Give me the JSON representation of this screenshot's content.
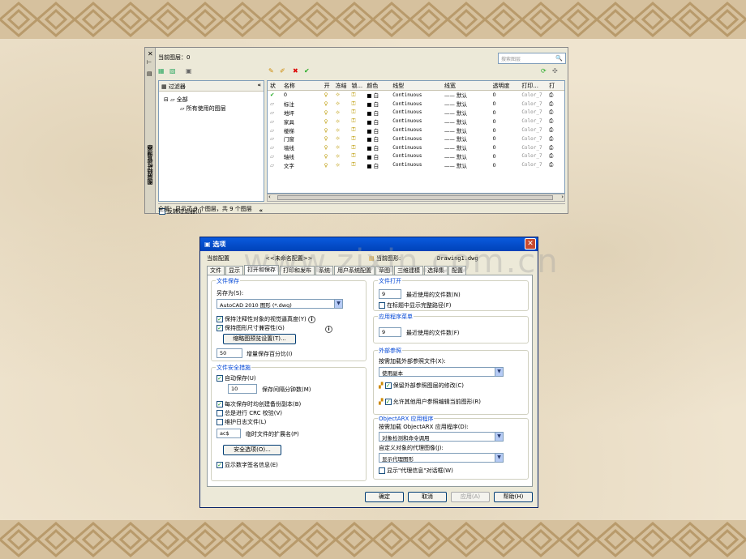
{
  "layer_manager": {
    "side_title": "图层特性管理器",
    "current_layer": "当前图层：0",
    "search_placeholder": "搜索图层",
    "filter_header": "过滤器",
    "tree_all": "全部",
    "tree_used": "所有使用的图层",
    "invert_filter": "反转过滤器(I)",
    "columns": [
      "状",
      "名称",
      "开",
      "冻结",
      "锁...",
      "颜色",
      "线型",
      "线宽",
      "透明度",
      "打印...",
      "打"
    ],
    "rows": [
      {
        "name": "0",
        "color": "白",
        "linetype": "Continuous",
        "lineweight": "默认",
        "transparency": "0",
        "plot": "Color_7"
      },
      {
        "name": "标注",
        "color": "白",
        "linetype": "Continuous",
        "lineweight": "默认",
        "transparency": "0",
        "plot": "Color_7"
      },
      {
        "name": "地坪",
        "color": "白",
        "linetype": "Continuous",
        "lineweight": "默认",
        "transparency": "0",
        "plot": "Color_7"
      },
      {
        "name": "家具",
        "color": "白",
        "linetype": "Continuous",
        "lineweight": "默认",
        "transparency": "0",
        "plot": "Color_7"
      },
      {
        "name": "楼梯",
        "color": "白",
        "linetype": "Continuous",
        "lineweight": "默认",
        "transparency": "0",
        "plot": "Color_7"
      },
      {
        "name": "门窗",
        "color": "白",
        "linetype": "Continuous",
        "lineweight": "默认",
        "transparency": "0",
        "plot": "Color_7"
      },
      {
        "name": "墙线",
        "color": "白",
        "linetype": "Continuous",
        "lineweight": "默认",
        "transparency": "0",
        "plot": "Color_7"
      },
      {
        "name": "轴线",
        "color": "白",
        "linetype": "Continuous",
        "lineweight": "默认",
        "transparency": "0",
        "plot": "Color_7"
      },
      {
        "name": "文字",
        "color": "白",
        "linetype": "Continuous",
        "lineweight": "默认",
        "transparency": "0",
        "plot": "Color_7"
      }
    ],
    "status": "全部：显示了 9 个图层，共 9 个图层"
  },
  "options": {
    "title": "选项",
    "current_profile_label": "当前配置",
    "current_profile_value": "<<未命名配置>>",
    "current_drawing_label": "当前图形:",
    "current_drawing_value": "Drawing1.dwg",
    "tabs": [
      "文件",
      "显示",
      "打开和保存",
      "打印和发布",
      "系统",
      "用户系统配置",
      "草图",
      "三维建模",
      "选择集",
      "配置"
    ],
    "active_tab": 2,
    "file_save": {
      "title": "文件保存",
      "save_as_label": "另存为(S):",
      "save_as_value": "AutoCAD 2010 图形 (*.dwg)",
      "keep_visual": "保持注释性对象的视觉逼真度(Y)",
      "keep_size": "保持图形尺寸兼容性(G)",
      "thumb_button": "缩略图预览设置(T)...",
      "incr_value": "50",
      "incr_label": "增量保存百分比(I)"
    },
    "file_safety": {
      "title": "文件安全措施",
      "autosave": "自动保存(U)",
      "minutes_value": "10",
      "minutes_label": "保存间隔分钟数(M)",
      "backup": "每次保存时均创建备份副本(B)",
      "crc": "总是进行 CRC 校验(V)",
      "log": "维护日志文件(L)",
      "ext_value": "ac$",
      "ext_label": "临时文件的扩展名(P)",
      "security_button": "安全选项(O)...",
      "digsig": "显示数字签名信息(E)"
    },
    "file_open": {
      "title": "文件打开",
      "recent_value": "9",
      "recent_label": "最近使用的文件数(N)",
      "fullpath": "在标题中显示完整路径(F)"
    },
    "app_menu": {
      "title": "应用程序菜单",
      "recent_value": "9",
      "recent_label": "最近使用的文件数(F)"
    },
    "xref": {
      "title": "外部参照",
      "demand_label": "按需加载外部参照文件(X):",
      "demand_value": "使用副本",
      "retain": "保留外部参照图层的修改(C)",
      "allow_edit": "允许其他用户参照编辑当前图形(R)"
    },
    "objectarx": {
      "title": "ObjectARX 应用程序",
      "load_label": "按需加载 ObjectARX 应用程序(D):",
      "load_value": "对象检测和命令调用",
      "proxy_label": "自定义对象的代理图像(J):",
      "proxy_value": "显示代理图形",
      "proxy_info": "显示\"代理信息\"对话框(W)"
    },
    "buttons": {
      "ok": "确定",
      "cancel": "取消",
      "apply": "应用(A)",
      "help": "帮助(H)"
    }
  },
  "watermark": "www.zixin.com.cn"
}
